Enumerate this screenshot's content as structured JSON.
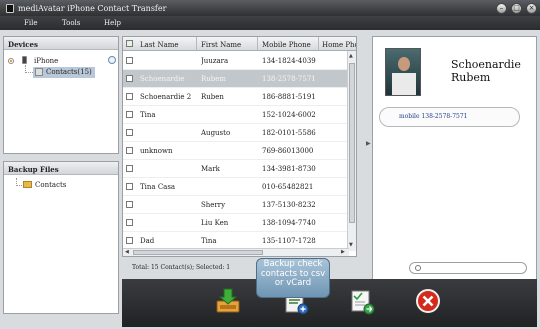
{
  "window": {
    "title": "mediAvatar iPhone Contact Transfer"
  },
  "menu": [
    "File",
    "Tools",
    "Help"
  ],
  "devices_panel": {
    "title": "Devices",
    "device": "iPhone",
    "child": "Contacts(15)"
  },
  "backup_panel": {
    "title": "Backup Files",
    "item": "Contacts"
  },
  "grid": {
    "columns": [
      "Last Name",
      "First Name",
      "Mobile Phone",
      "Home Phone"
    ],
    "rows": [
      {
        "last": "",
        "first": "Juuzara",
        "mobile": "134-1824-4039",
        "selected": false
      },
      {
        "last": "Schoenardie",
        "first": "Rubem",
        "mobile": "138-2578-7571",
        "selected": true
      },
      {
        "last": "Schoenardie 2",
        "first": "Ruben",
        "mobile": "186-8881-5191",
        "selected": false
      },
      {
        "last": "Tina",
        "first": "",
        "mobile": "152-1024-6002",
        "selected": false
      },
      {
        "last": "",
        "first": "Augusto",
        "mobile": "182-0101-5586",
        "selected": false
      },
      {
        "last": "unknown",
        "first": "",
        "mobile": "769-86013000",
        "selected": false
      },
      {
        "last": "",
        "first": "Mark",
        "mobile": "134-3981-8730",
        "selected": false
      },
      {
        "last": "Tina Casa",
        "first": "",
        "mobile": "010-65482821",
        "selected": false
      },
      {
        "last": "",
        "first": "Sherry",
        "mobile": "137-5130-8232",
        "selected": false
      },
      {
        "last": "",
        "first": "Liu Ken",
        "mobile": "138-1094-7740",
        "selected": false
      },
      {
        "last": "Dad",
        "first": "Tina",
        "mobile": "135-1107-1728",
        "selected": false
      }
    ]
  },
  "detail": {
    "name_line1": "Schoenardie",
    "name_line2": "Rubem",
    "phone_label": "mobile",
    "phone": "138-2578-7571"
  },
  "status": {
    "text": "Total: 15 Contact(s); Selected: 1"
  },
  "tooltip": {
    "line1": "Backup check",
    "line2": "contacts to csv",
    "line3": "or vCard"
  },
  "toolbar": {
    "buttons": [
      "import-icon",
      "backup-icon",
      "export-csv-icon",
      "delete-icon"
    ]
  },
  "colors": {
    "accent": "#e89a1c",
    "selected_row": "#c2c7cc",
    "toolbar": "#2b2d30",
    "delete": "#d42a1c"
  }
}
